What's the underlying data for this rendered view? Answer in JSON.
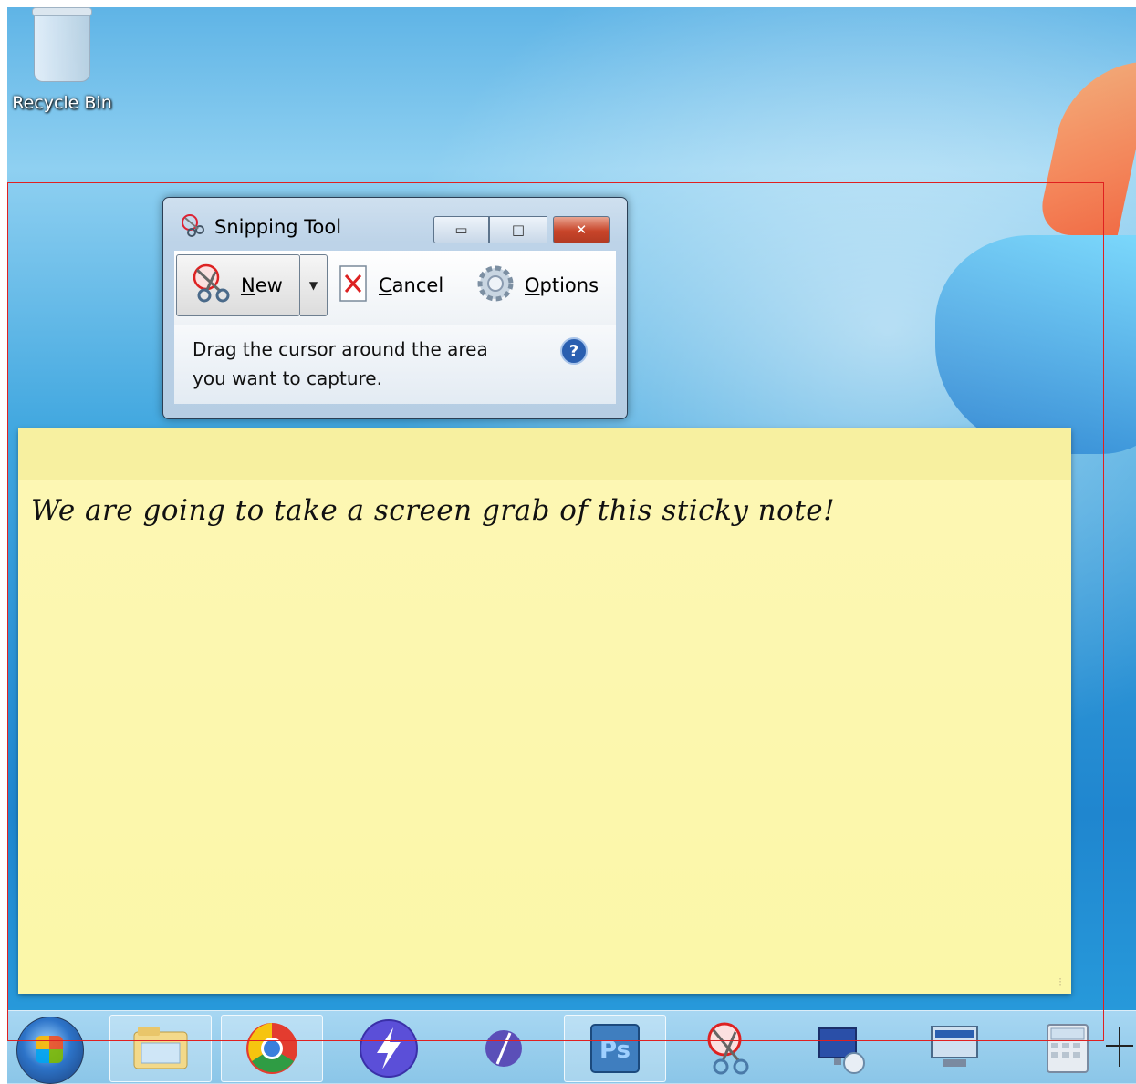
{
  "desktop": {
    "icons": [
      {
        "name": "recycle-bin",
        "label": "Recycle Bin"
      }
    ]
  },
  "snipping_tool": {
    "title": "Snipping Tool",
    "controls": {
      "minimize_glyph": "▭",
      "maximize_glyph": "□",
      "close_glyph": "✕"
    },
    "toolbar": {
      "new_label": "New",
      "new_mnemonic": "N",
      "new_rest": "ew",
      "dropdown_glyph": "▼",
      "cancel_mnemonic": "C",
      "cancel_rest": "ancel",
      "options_mnemonic": "O",
      "options_rest": "ptions"
    },
    "instruction": "Drag the cursor around the area you want to capture.",
    "help_glyph": "?"
  },
  "sticky_note": {
    "text": "We are going to take a screen grab of this sticky note!",
    "grip_glyph": "⁝"
  },
  "taskbar": {
    "items": [
      {
        "icon": "windows-explorer-icon"
      },
      {
        "icon": "chrome-icon"
      },
      {
        "icon": "lightning-app-icon"
      },
      {
        "icon": "feather-app-icon"
      },
      {
        "icon": "photoshop-icon",
        "text": "Ps"
      },
      {
        "icon": "snipping-tool-icon"
      },
      {
        "icon": "remote-desktop-icon"
      },
      {
        "icon": "network-computer-icon"
      },
      {
        "icon": "calculator-icon"
      }
    ]
  },
  "colors": {
    "selection_border": "#e02020",
    "sticky_bg": "#fbf7a8",
    "close_button": "#c8452a"
  }
}
